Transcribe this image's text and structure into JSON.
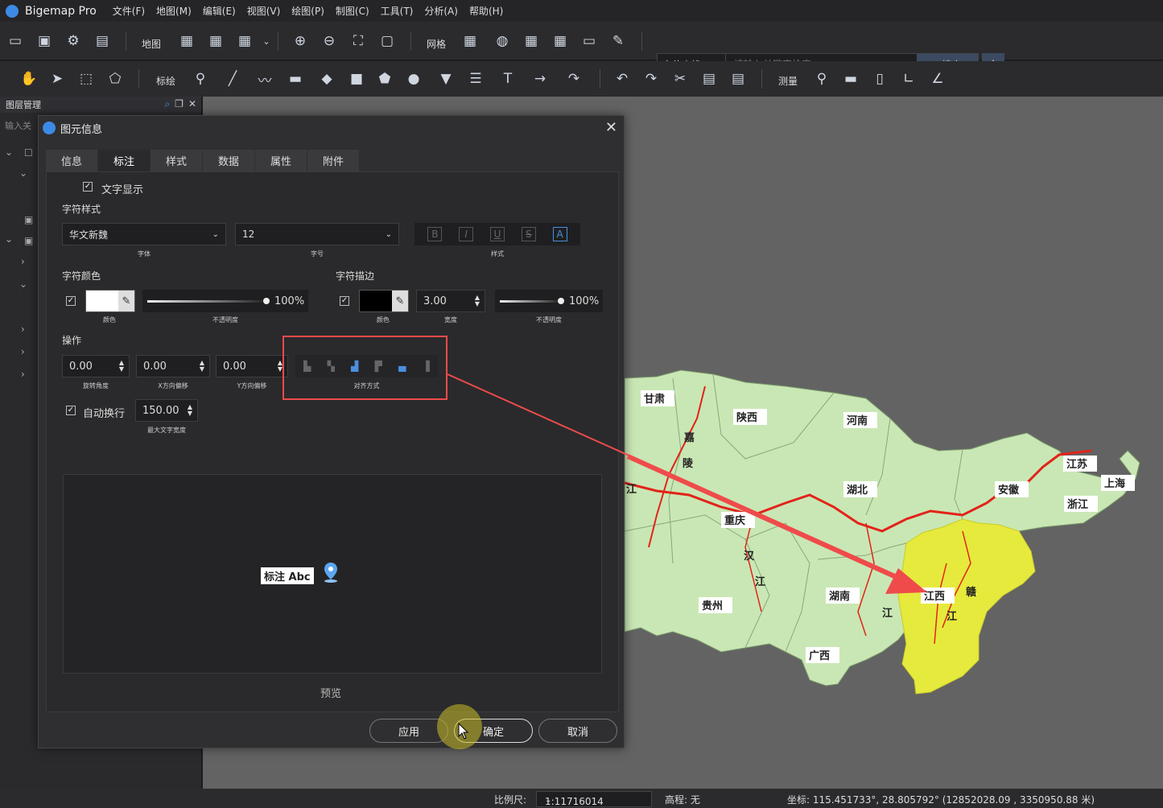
{
  "app": {
    "name": "Bigemap Pro"
  },
  "menu": [
    "文件(F)",
    "地图(M)",
    "编辑(E)",
    "视图(V)",
    "绘图(P)",
    "制图(C)",
    "工具(T)",
    "分析(A)",
    "帮助(H)"
  ],
  "toolbar1": {
    "map_label": "地图",
    "grid_label": "网格",
    "locate_label": "定位查找",
    "search_placeholder": "请输入关键字检索",
    "search_button": "搜索"
  },
  "toolbar2": {
    "annotate_label": "标绘",
    "measure_label": "测量"
  },
  "layer_panel": {
    "title": "图层管理",
    "search_placeholder": "输入关"
  },
  "dialog": {
    "title": "图元信息",
    "tabs": [
      "信息",
      "标注",
      "样式",
      "数据",
      "属性",
      "附件"
    ],
    "active_tab": "标注",
    "text_display": "文字显示",
    "char_style": "字符样式",
    "font": {
      "value": "华文新魏",
      "caption": "字体"
    },
    "size": {
      "value": "12",
      "caption": "字号"
    },
    "style_caption": "样式",
    "style_buttons": [
      "B",
      "I",
      "U",
      "S",
      "A"
    ],
    "char_color": {
      "label": "字符颜色",
      "color": "#ffffff",
      "color_caption": "颜色",
      "opacity": "100%",
      "opacity_caption": "不透明度"
    },
    "char_stroke": {
      "label": "字符描边",
      "color": "#000000",
      "color_caption": "颜色",
      "width": "3.00",
      "width_caption": "宽度",
      "opacity": "100%",
      "opacity_caption": "不透明度"
    },
    "operation": {
      "label": "操作",
      "rotation": "0.00",
      "rotation_caption": "旋转角度",
      "x_offset": "0.00",
      "x_caption": "X方向偏移",
      "y_offset": "0.00",
      "y_caption": "Y方向偏移",
      "align_caption": "对齐方式"
    },
    "auto_wrap": {
      "label": "自动换行",
      "max_width": "150.00",
      "caption": "最大文字宽度"
    },
    "preview_sample": "标注 Abc",
    "preview_label": "预览",
    "buttons": {
      "apply": "应用",
      "ok": "确定",
      "cancel": "取消"
    }
  },
  "map_labels": [
    "甘肃",
    "陕西",
    "河南",
    "江苏",
    "上海",
    "安徽",
    "浙江",
    "湖北",
    "重庆",
    "湖南",
    "江西",
    "贵州",
    "广西",
    "嘉",
    "陵",
    "汉",
    "江",
    "赣",
    "江",
    "江",
    "江"
  ],
  "status": {
    "scale_label": "比例尺:",
    "scale_value": "1:11716014",
    "elevation": "高程: 无",
    "coords": "坐标: 115.451733°, 28.805792°  (12852028.09 , 3350950.88 米)"
  },
  "colors": {
    "accent": "#3d8ae6",
    "highlight_red": "#ef4b4b",
    "jiangxi_yellow": "#e6ea3c",
    "province_green": "#c9e7b4",
    "border_red": "#e2231a"
  }
}
